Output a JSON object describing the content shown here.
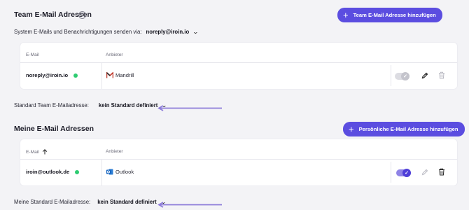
{
  "team_section": {
    "title": "Team E-Mail Adressen",
    "help_glyph": "?",
    "add_button": "Team E-Mail Adresse hinzufügen",
    "system_label": "System E-Mails und Benachrichtigungen senden via:",
    "system_value": "noreply@iroin.io",
    "table": {
      "col_email": "E-Mail",
      "col_provider": "Anbieter",
      "rows": [
        {
          "email": "noreply@iroin.io",
          "status_color": "#2ecc71",
          "provider": "Mandrill",
          "provider_icon": "mandrill-icon",
          "enabled": true,
          "toggle_disabled": true
        }
      ]
    },
    "default_label": "Standard Team E-Mailadresse:",
    "default_value": "kein Standard definiert"
  },
  "personal_section": {
    "title": "Meine E-Mail Adressen",
    "add_button": "Persönliche E-Mail Adresse hinzufügen",
    "table": {
      "col_email": "E-Mail",
      "col_provider": "Anbieter",
      "rows": [
        {
          "email": "iroin@outlook.de",
          "status_color": "#2ecc71",
          "provider": "Outlook",
          "provider_icon": "outlook-icon",
          "enabled": true,
          "toggle_disabled": false
        }
      ]
    },
    "default_label": "Meine Standard E-Mailadresse:",
    "default_value": "kein Standard definiert"
  },
  "colors": {
    "accent": "#5b4de0",
    "annotation_arrow": "#8c7bd9",
    "status_online": "#2ecc71"
  }
}
